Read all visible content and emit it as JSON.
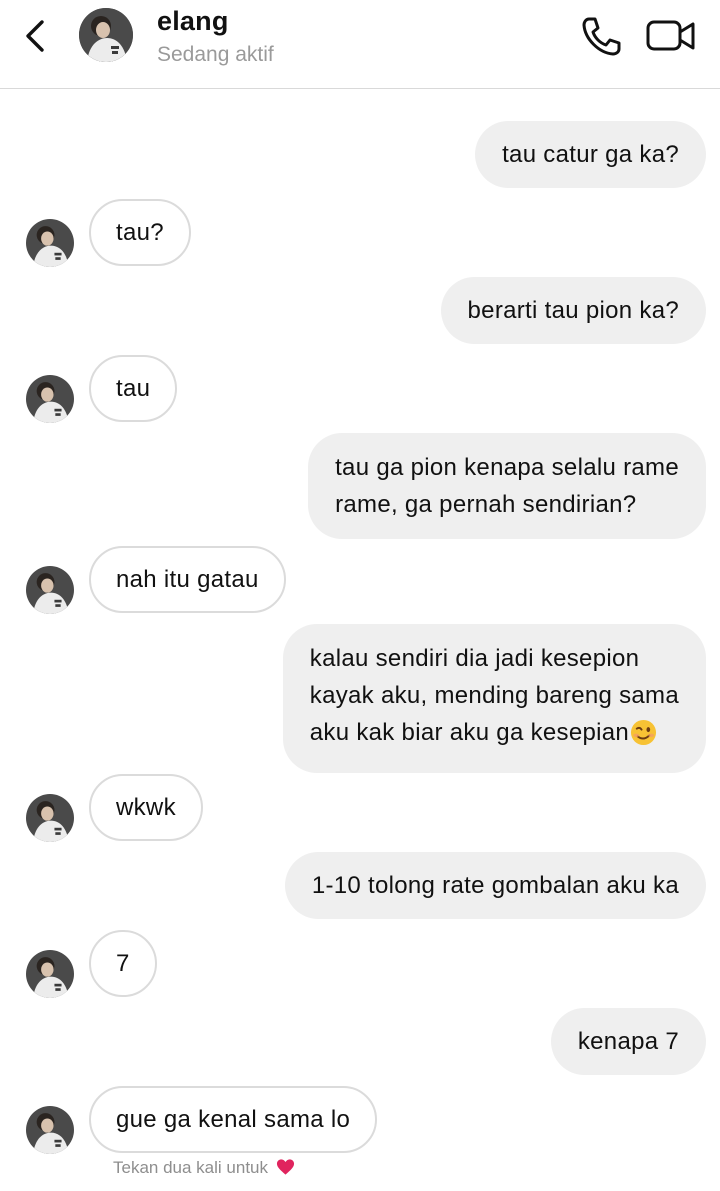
{
  "header": {
    "back_icon": "chevron-left-icon",
    "contact_name": "elang",
    "contact_status": "Sedang aktif",
    "call_icon": "phone-icon",
    "video_icon": "video-camera-icon"
  },
  "messages": [
    {
      "from": "me",
      "text": "tau catur ga ka?"
    },
    {
      "from": "them",
      "text": "tau?"
    },
    {
      "from": "me",
      "text": "berarti tau pion ka?"
    },
    {
      "from": "them",
      "text": "tau"
    },
    {
      "from": "me",
      "lines": [
        "tau ga pion kenapa selalu rame",
        "rame, ga pernah sendirian?"
      ]
    },
    {
      "from": "them",
      "text": "nah itu gatau"
    },
    {
      "from": "me",
      "lines": [
        "kalau sendiri dia jadi kesepion",
        "kayak aku, mending bareng sama",
        "aku kak biar aku ga kesepian"
      ],
      "emoji": "winking-face-emoji"
    },
    {
      "from": "them",
      "text": "wkwk"
    },
    {
      "from": "me",
      "text": "1-10 tolong rate gombalan aku ka"
    },
    {
      "from": "them",
      "text": "7"
    },
    {
      "from": "me",
      "text": "kenapa 7"
    },
    {
      "from": "them",
      "text": "gue ga kenal sama lo"
    }
  ],
  "footer_hint": {
    "text": "Tekan dua kali untuk",
    "icon": "red-heart-icon"
  },
  "colors": {
    "sent_bubble": "#efefef",
    "received_border": "#dbdbdb",
    "muted_text": "#9a9a9a",
    "heart": "#e0245e"
  }
}
